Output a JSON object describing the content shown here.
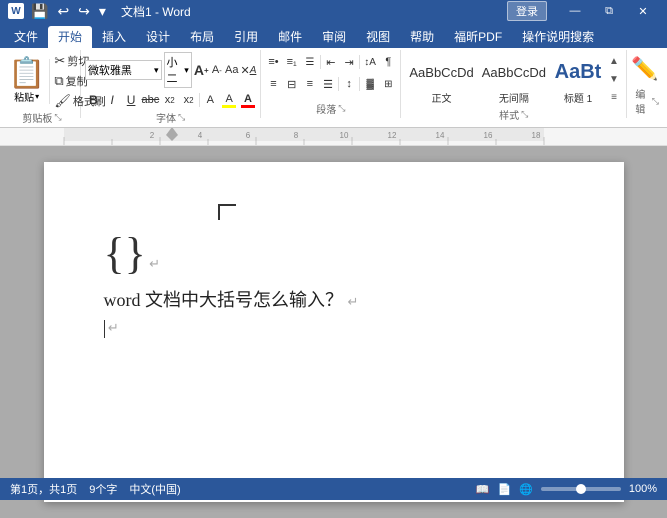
{
  "titlebar": {
    "filename": "文档1",
    "appname": "Word",
    "title_full": "文档1 - Word",
    "login_label": "登录",
    "min_btn": "—",
    "max_btn": "□",
    "close_btn": "✕",
    "restore_btn": "❐",
    "qat_save": "💾",
    "qat_undo": "↩",
    "qat_redo": "↪"
  },
  "tabs": [
    {
      "label": "文件",
      "active": false
    },
    {
      "label": "开始",
      "active": true
    },
    {
      "label": "插入",
      "active": false
    },
    {
      "label": "设计",
      "active": false
    },
    {
      "label": "布局",
      "active": false
    },
    {
      "label": "引用",
      "active": false
    },
    {
      "label": "邮件",
      "active": false
    },
    {
      "label": "审阅",
      "active": false
    },
    {
      "label": "视图",
      "active": false
    },
    {
      "label": "帮助",
      "active": false
    },
    {
      "label": "福昕PDF",
      "active": false
    },
    {
      "label": "操作说明搜索",
      "active": false
    }
  ],
  "ribbon": {
    "clipboard": {
      "paste_label": "粘贴",
      "cut_label": "剪切",
      "copy_label": "复制",
      "format_painter_label": "格式刷",
      "group_label": "剪贴板"
    },
    "font": {
      "font_name": "微软雅黑",
      "font_size": "小二",
      "bold": "B",
      "italic": "I",
      "underline": "U",
      "strikethrough": "abc",
      "subscript": "x₂",
      "superscript": "x²",
      "text_highlight": "A",
      "font_color": "A",
      "grow": "A↑",
      "shrink": "A↓",
      "change_case": "Aa",
      "clear_format": "✕A",
      "group_label": "字体"
    },
    "paragraph": {
      "bullets": "≡•",
      "numbering": "≡1",
      "multilevel": "≡☰",
      "decrease_indent": "⇤",
      "increase_indent": "⇥",
      "sort": "↕A",
      "show_marks": "¶",
      "align_left": "≡L",
      "align_center": "≡C",
      "align_right": "≡R",
      "justify": "≡J",
      "line_spacing": "↕≡",
      "shading": "🎨",
      "borders": "⊞",
      "group_label": "段落"
    },
    "styles": {
      "items": [
        {
          "label": "正文",
          "preview": "AaBbCcDd",
          "preview_style": "normal"
        },
        {
          "label": "无间隔",
          "preview": "AaBbCcDd",
          "preview_style": "normal"
        },
        {
          "label": "标题 1",
          "preview": "AaBt",
          "preview_style": "heading1"
        }
      ],
      "group_label": "样式"
    },
    "editing": {
      "group_label": "编辑"
    }
  },
  "document": {
    "main_text": "word 文档中大括号怎么输入？",
    "brace_char": "{}",
    "para_mark": "↵",
    "cursor_visible": true
  },
  "statusbar": {
    "page_info": "第1页，共1页",
    "word_count": "9个字",
    "lang": "中文(中国)",
    "zoom": "100%"
  }
}
